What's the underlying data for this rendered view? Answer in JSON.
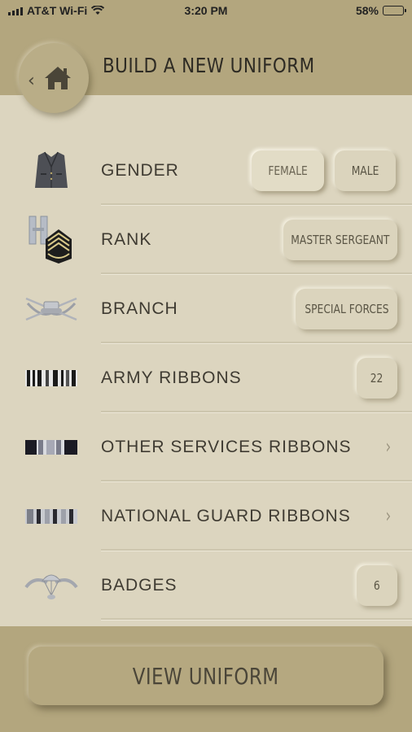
{
  "status": {
    "carrier": "AT&T Wi-Fi",
    "time": "3:20 PM",
    "battery_text": "58%",
    "battery_level": 0.58
  },
  "header": {
    "title": "BUILD A NEW UNIFORM",
    "back_icon": "chevron-left-icon",
    "home_icon": "home-icon"
  },
  "rows": [
    {
      "label": "GENDER",
      "icon": "jacket-icon",
      "options": [
        "FEMALE",
        "MALE"
      ],
      "selected": "FEMALE"
    },
    {
      "label": "RANK",
      "icon": "rank-insignia-icon",
      "value": "MASTER SERGEANT"
    },
    {
      "label": "BRANCH",
      "icon": "branch-insignia-icon",
      "value": "SPECIAL FORCES"
    },
    {
      "label": "ARMY RIBBONS",
      "icon": "ribbon-icon",
      "count": "22"
    },
    {
      "label": "OTHER SERVICES RIBBONS",
      "icon": "ribbon-icon"
    },
    {
      "label": "NATIONAL GUARD RIBBONS",
      "icon": "ribbon-icon"
    },
    {
      "label": "BADGES",
      "icon": "parachute-badge-icon",
      "count": "6"
    }
  ],
  "footer": {
    "button_label": "VIEW UNIFORM"
  },
  "colors": {
    "background": "#dcd5bf",
    "header": "#b3a67e",
    "text": "#3f3b32"
  }
}
